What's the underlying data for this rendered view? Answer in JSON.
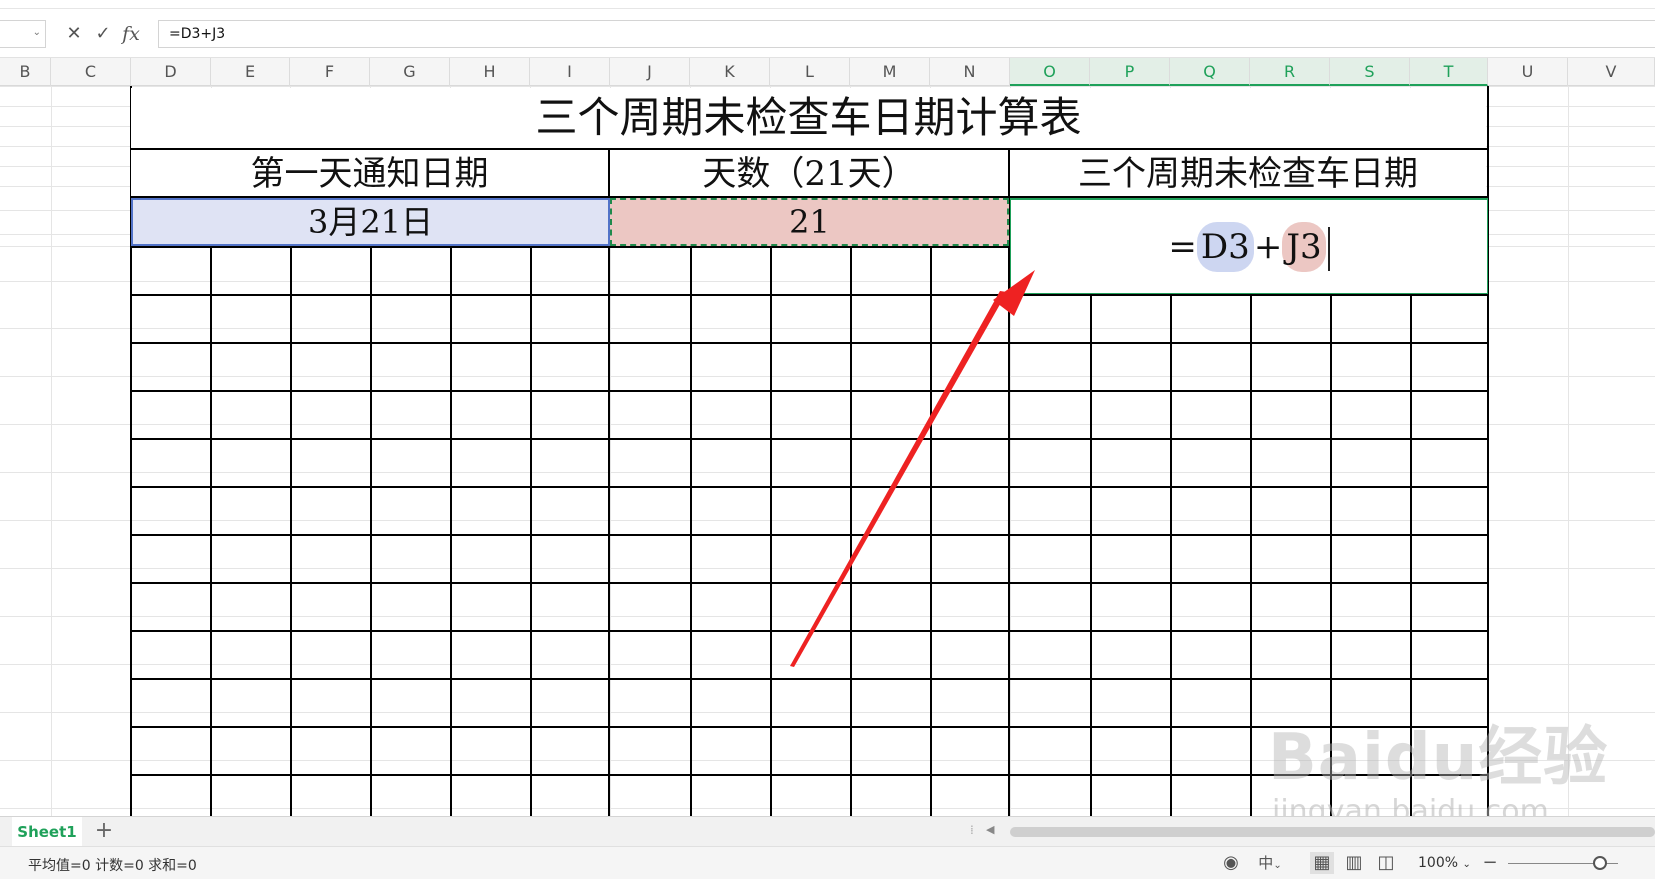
{
  "formula_bar": {
    "cancel_icon": "close-icon",
    "confirm_icon": "check-icon",
    "fx_label": "fx",
    "formula": "=D3+J3"
  },
  "columns": [
    "B",
    "C",
    "D",
    "E",
    "F",
    "G",
    "H",
    "I",
    "J",
    "K",
    "L",
    "M",
    "N",
    "O",
    "P",
    "Q",
    "R",
    "S",
    "T",
    "U",
    "V"
  ],
  "selected_columns": [
    "O",
    "P",
    "Q",
    "R",
    "S",
    "T"
  ],
  "sheet": {
    "title": "三个周期未检查车日期计算表",
    "header_first_day": "第一天通知日期",
    "header_days": "天数（21天）",
    "header_result": "三个周期未检查车日期",
    "d3_value": "3月21日",
    "j3_value": "21",
    "formula_eq": "=",
    "formula_ref1": "D3",
    "formula_plus": "+",
    "formula_ref2": "J3"
  },
  "colors": {
    "ref1_fill": "#dfe3f4",
    "ref2_fill": "#ecc7c3",
    "active_green": "#1fa15a",
    "arrow_red": "#ee2222"
  },
  "watermark": {
    "brand": "Baidu经验",
    "url": "jingyan.baidu.com"
  },
  "tabs": {
    "sheet_name": "Sheet1",
    "add_label": "+"
  },
  "status": {
    "summary": "平均值=0  计数=0  求和=0",
    "input_mode": "中",
    "zoom": "100%"
  }
}
